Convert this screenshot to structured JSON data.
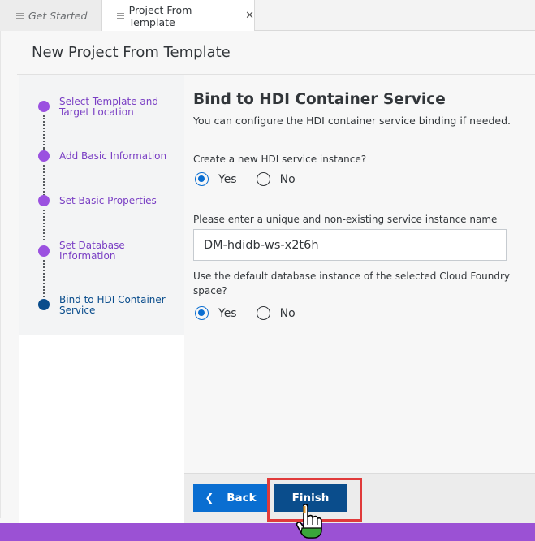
{
  "tabs": [
    {
      "label": "Get Started"
    },
    {
      "label": "Project From Template",
      "close": "✕"
    }
  ],
  "page_title": "New Project From Template",
  "steps": [
    {
      "label": "Select Template and Target Location",
      "state": "done"
    },
    {
      "label": "Add Basic Information",
      "state": "done"
    },
    {
      "label": "Set Basic Properties",
      "state": "done"
    },
    {
      "label": "Set Database Information",
      "state": "done"
    },
    {
      "label": "Bind to HDI Container Service",
      "state": "current"
    }
  ],
  "section": {
    "title": "Bind to HDI Container Service",
    "subtitle": "You can configure the HDI container service binding if needed."
  },
  "question1": {
    "label": "Create a new HDI service instance?",
    "options": [
      "Yes",
      "No"
    ],
    "selected": "Yes"
  },
  "service_name": {
    "label": "Please enter a unique and non-existing service instance name",
    "value": "DM-hdidb-ws-x2t6h"
  },
  "question2": {
    "label": "Use the default database instance of the selected Cloud Foundry space?",
    "options": [
      "Yes",
      "No"
    ],
    "selected": "Yes"
  },
  "buttons": {
    "back": "Back",
    "finish": "Finish"
  },
  "colors": {
    "accent": "#0a6ed1",
    "finish": "#0a4d8c",
    "step_done": "#9b51e0",
    "highlight": "#e03a3a",
    "bottom_bar": "#9b51d4"
  }
}
